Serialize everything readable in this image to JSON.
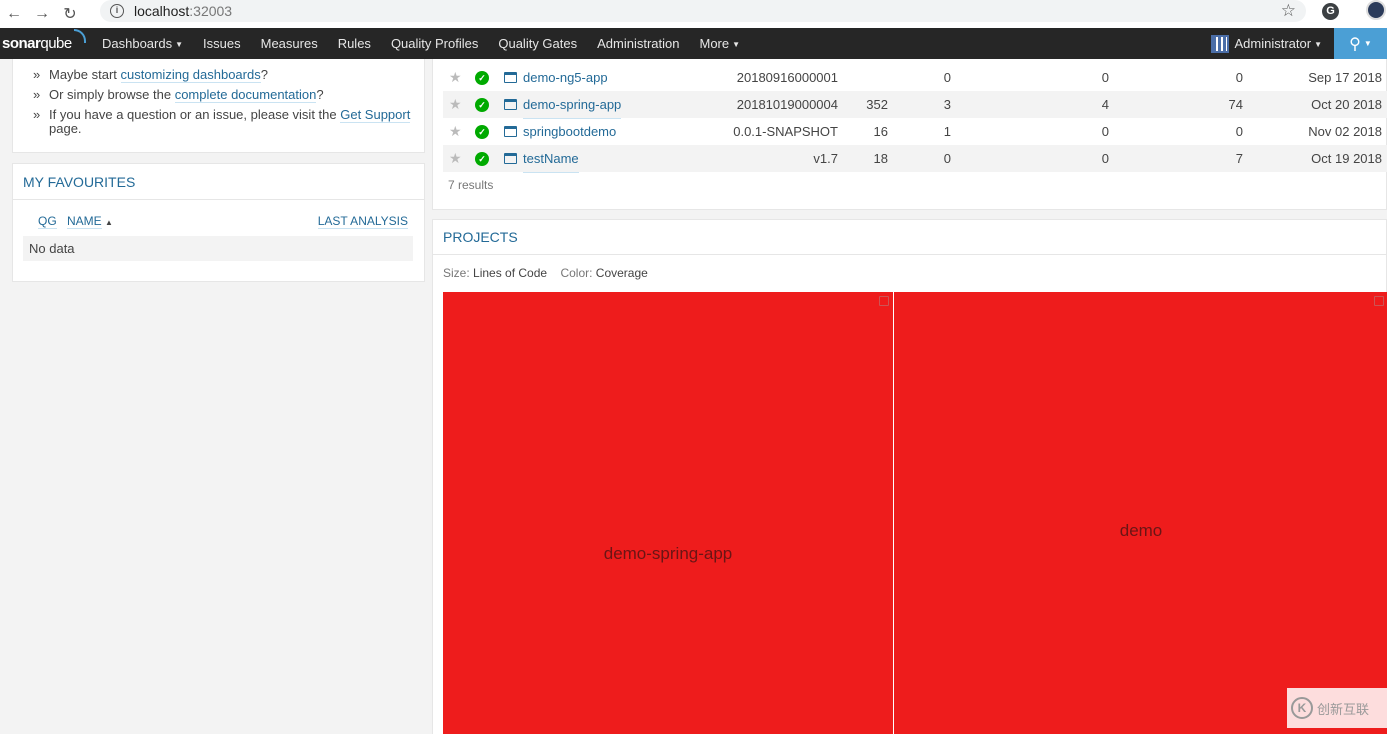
{
  "browser": {
    "host": "localhost",
    "port": ":32003"
  },
  "navbar": {
    "logo_sonar": "sonar",
    "logo_qube": "qube",
    "items": [
      "Dashboards",
      "Issues",
      "Measures",
      "Rules",
      "Quality Profiles",
      "Quality Gates",
      "Administration",
      "More"
    ],
    "user": "Administrator"
  },
  "links": {
    "item1_pre": "Maybe start ",
    "item1_link": "customizing dashboards",
    "item1_post": "?",
    "item2_pre": "Or simply browse the ",
    "item2_link": "complete documentation",
    "item2_post": "?",
    "item3_pre": "If you have a question or an issue, please visit the ",
    "item3_link": "Get Support",
    "item3_cont": "page."
  },
  "favourites": {
    "title": "MY FAVOURITES",
    "col_qg": "QG",
    "col_name": "NAME",
    "col_last": "LAST ANALYSIS",
    "empty": "No data"
  },
  "projects_table": {
    "rows": [
      {
        "name": "demo-ng5-app",
        "version": "20180916000001",
        "c1": "",
        "c2": "0",
        "c3": "0",
        "c4": "0",
        "date": "Sep 17 2018"
      },
      {
        "name": "demo-spring-app",
        "version": "20181019000004",
        "c1": "352",
        "c2": "3",
        "c3": "4",
        "c4": "74",
        "date": "Oct 20 2018"
      },
      {
        "name": "springbootdemo",
        "version": "0.0.1-SNAPSHOT",
        "c1": "16",
        "c2": "1",
        "c3": "0",
        "c4": "0",
        "date": "Nov 02 2018"
      },
      {
        "name": "testName",
        "version": "v1.7",
        "c1": "18",
        "c2": "0",
        "c3": "0",
        "c4": "7",
        "date": "Oct 19 2018"
      }
    ],
    "results": "7 results"
  },
  "treemap": {
    "title": "PROJECTS",
    "size_label": "Size:",
    "size_value": "Lines of Code",
    "color_label": "Color:",
    "color_value": "Coverage",
    "tiles": [
      {
        "name": "demo-spring-app",
        "color": "#ee1c1c"
      },
      {
        "name": "demo",
        "color": "#ee1c1c"
      }
    ]
  },
  "watermark": {
    "text": "创新互联"
  }
}
